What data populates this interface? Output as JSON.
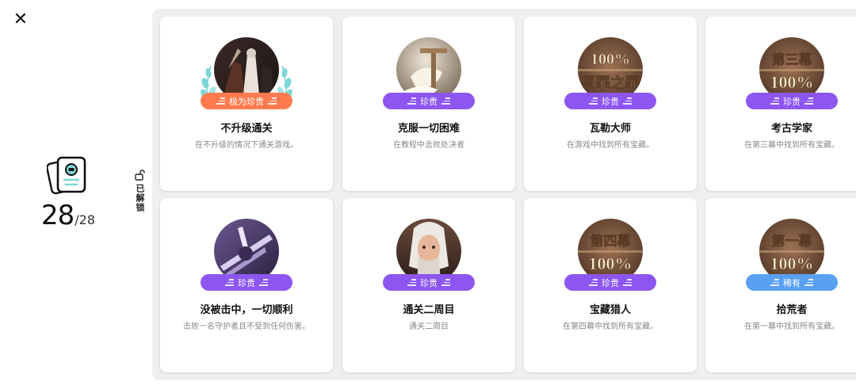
{
  "header": {
    "close_icon": "close-icon",
    "close_glyph": "✕"
  },
  "summary": {
    "unlocked": "28",
    "total": "/28",
    "icon": "achievement-book-icon"
  },
  "filter": {
    "label": "已解锁",
    "icon": "lock-icon"
  },
  "colors": {
    "legendary": "#ff7b4f",
    "precious": "#8d56f0",
    "rare": "#5aa0f2",
    "laurel": "#7fd6d6"
  },
  "achievements": [
    {
      "title": "不升级通关",
      "desc": "在不升级的情况下通关游戏。",
      "rarity": "极为珍贵",
      "tier": "legendary",
      "art_text": []
    },
    {
      "title": "克服一切困难",
      "desc": "在教程中击败处决者",
      "rarity": "珍贵",
      "tier": "precious",
      "art_text": []
    },
    {
      "title": "瓦勒大师",
      "desc": "在游戏中找到所有宝藏。",
      "rarity": "珍贵",
      "tier": "precious",
      "art_text": [
        "100%",
        "原罪之罪"
      ]
    },
    {
      "title": "考古学家",
      "desc": "在第三幕中找到所有宝藏。",
      "rarity": "珍贵",
      "tier": "precious",
      "art_text": [
        "第三幕",
        "100%"
      ]
    },
    {
      "title": "没被击中，一切顺利",
      "desc": "击败一名守护者且不受到任何伤害。",
      "rarity": "珍贵",
      "tier": "precious",
      "art_text": []
    },
    {
      "title": "通关二周目",
      "desc": "通关二周目",
      "rarity": "珍贵",
      "tier": "precious",
      "art_text": []
    },
    {
      "title": "宝藏猎人",
      "desc": "在第四幕中找到所有宝藏。",
      "rarity": "珍贵",
      "tier": "precious",
      "art_text": [
        "第四幕",
        "100%"
      ]
    },
    {
      "title": "拾荒者",
      "desc": "在第一幕中找到所有宝藏。",
      "rarity": "稀有",
      "tier": "rare",
      "art_text": [
        "第一幕",
        "100%"
      ]
    }
  ]
}
